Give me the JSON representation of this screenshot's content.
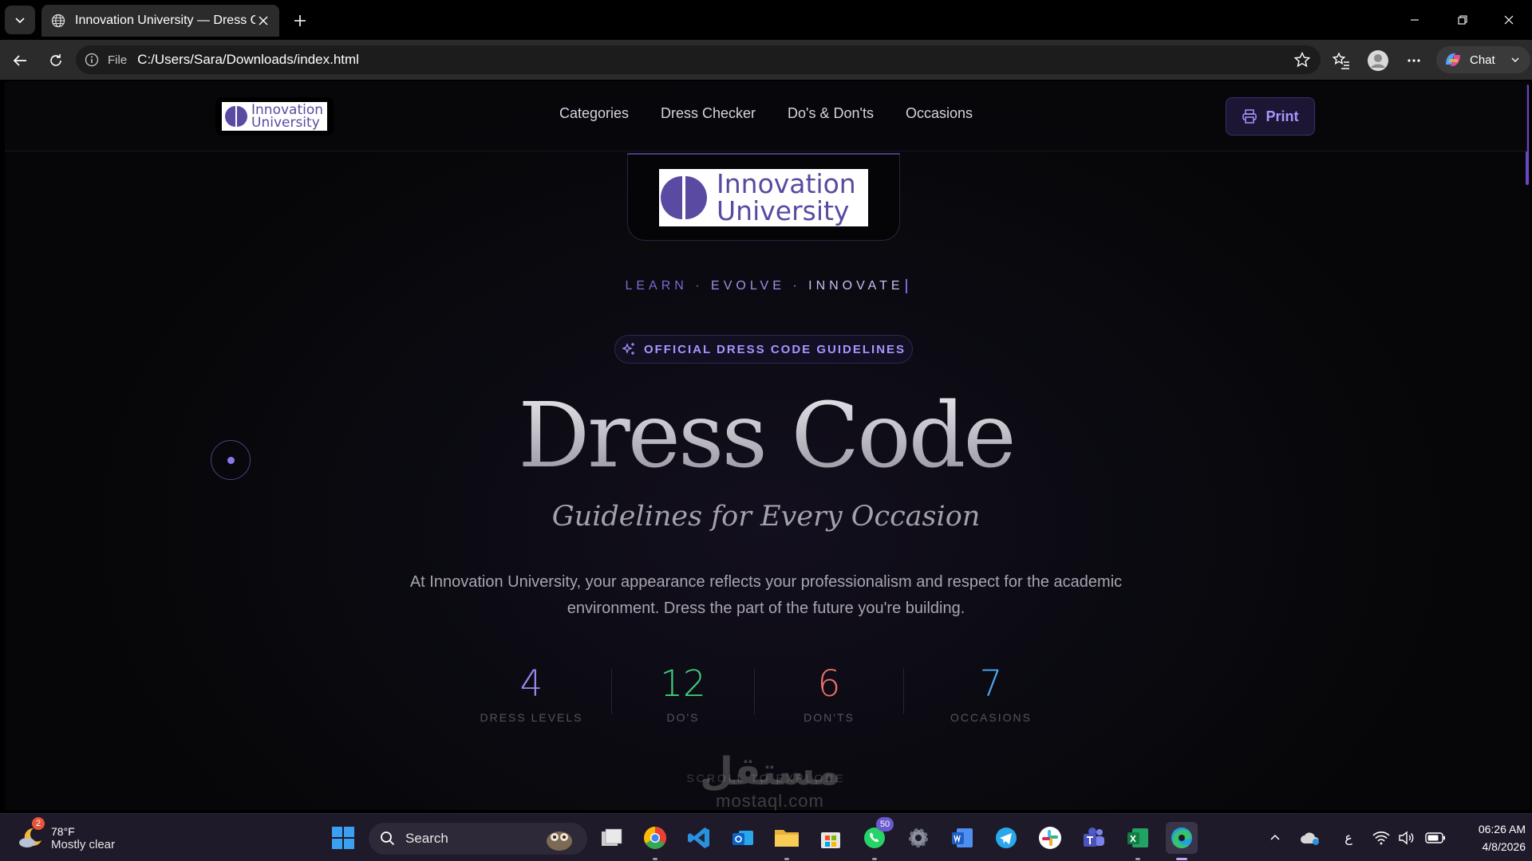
{
  "browser": {
    "tab_title": "Innovation University — Dress Cod",
    "file_label": "File",
    "url": "C:/Users/Sara/Downloads/index.html",
    "copilot_label": "Chat"
  },
  "site": {
    "logo_line1": "Innovation",
    "logo_line2": "University",
    "nav": [
      "Categories",
      "Dress Checker",
      "Do's & Don'ts",
      "Occasions"
    ],
    "print_label": "Print",
    "tagline": {
      "part1": "LEARN",
      "sep": "·",
      "part2": "EVOLVE",
      "part3": "INNOVATE"
    },
    "badge": "OFFICIAL DRESS CODE GUIDELINES",
    "title": "Dress Code",
    "subtitle": "Guidelines for Every Occasion",
    "description": "At Innovation University, your appearance reflects your professionalism and respect for the academic environment. Dress the part of the future you're building.",
    "stats": [
      {
        "value": "4",
        "label": "DRESS LEVELS",
        "color": "#9b87f5"
      },
      {
        "value": "12",
        "label": "DO'S",
        "color": "#3ecf7a"
      },
      {
        "value": "6",
        "label": "DON'TS",
        "color": "#f0736a"
      },
      {
        "value": "7",
        "label": "OCCASIONS",
        "color": "#4ea8f0"
      }
    ],
    "scroll_hint": "SCROLL TO EXPLORE",
    "accent": "#8b78ee"
  },
  "watermark": {
    "arabic": "مستقل",
    "latin": "mostaql.com"
  },
  "taskbar": {
    "weather_badge": "2",
    "temperature": "78°F",
    "condition": "Mostly clear",
    "search_label": "Search",
    "whatsapp_badge": "50",
    "lang": "ع",
    "time": "06:26 AM",
    "date": "4/8/2026"
  }
}
